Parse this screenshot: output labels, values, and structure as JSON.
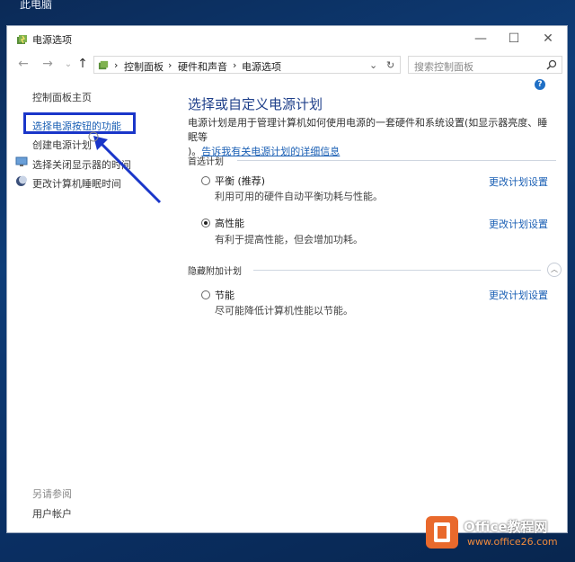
{
  "desktop": {
    "label": "此电脑"
  },
  "window": {
    "title": "电源选项",
    "buttons": {
      "minimize": "—",
      "maximize": "☐",
      "close": "✕"
    }
  },
  "address": {
    "back": "←",
    "forward": "→",
    "up": "↑",
    "crumbs": [
      "控制面板",
      "硬件和声音",
      "电源选项"
    ],
    "separator": "›",
    "dropdown": "⌄",
    "refresh": "↻",
    "search_placeholder": "搜索控制面板",
    "help": "?"
  },
  "sidebar": {
    "home": "控制面板主页",
    "items": [
      {
        "label": "选择电源按钮的功能"
      },
      {
        "label": "创建电源计划"
      },
      {
        "label": "选择关闭显示器的时间"
      },
      {
        "label": "更改计算机睡眠时间"
      }
    ],
    "see_also": "另请参阅",
    "user_accounts": "用户帐户"
  },
  "main": {
    "heading": "选择或自定义电源计划",
    "desc": "电源计划是用于管理计算机如何使用电源的一套硬件和系统设置(如显示器亮度、睡眠等",
    "desc2": ")。",
    "desc_link": "告诉我有关电源计划的详细信息",
    "preferred_label": "首选计划",
    "hidden_label": "隐藏附加计划",
    "change_label": "更改计划设置",
    "plans": [
      {
        "name": "平衡 (推荐)",
        "desc": "利用可用的硬件自动平衡功耗与性能。",
        "selected": false
      },
      {
        "name": "高性能",
        "desc": "有利于提高性能，但会增加功耗。",
        "selected": true
      },
      {
        "name": "节能",
        "desc": "尽可能降低计算机性能以节能。",
        "selected": false
      }
    ]
  },
  "watermark": {
    "brand": "Office教程网",
    "url": "www.office26.com"
  },
  "colors": {
    "accent": "#1a5fb4",
    "highlight_box": "#1a36c9",
    "arrow": "#1a36c9",
    "desktop_bg": "#0e3d78"
  }
}
